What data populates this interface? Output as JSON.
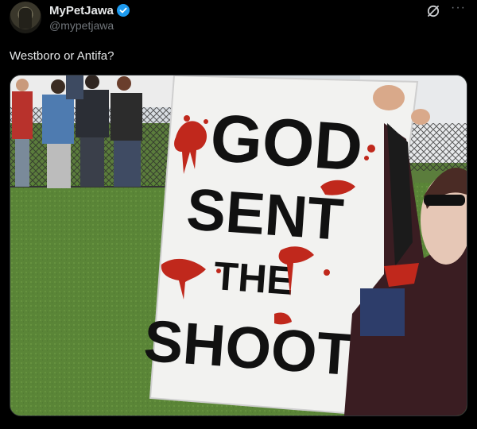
{
  "post": {
    "author_name": "MyPetJawa",
    "author_handle": "@mypetjawa",
    "text": "Westboro or Antifa?"
  },
  "icons": {
    "verified": "verified-badge-icon",
    "grok": "grok-icon",
    "more": "more-options-icon"
  },
  "image": {
    "sign_lines": [
      "GOD",
      "SENT",
      "THE",
      "SHOOTER"
    ]
  },
  "colors": {
    "background": "#000000",
    "text": "#e7e9ea",
    "secondary": "#71767b",
    "verified": "#1d9bf0",
    "blood": "#c0281c"
  }
}
